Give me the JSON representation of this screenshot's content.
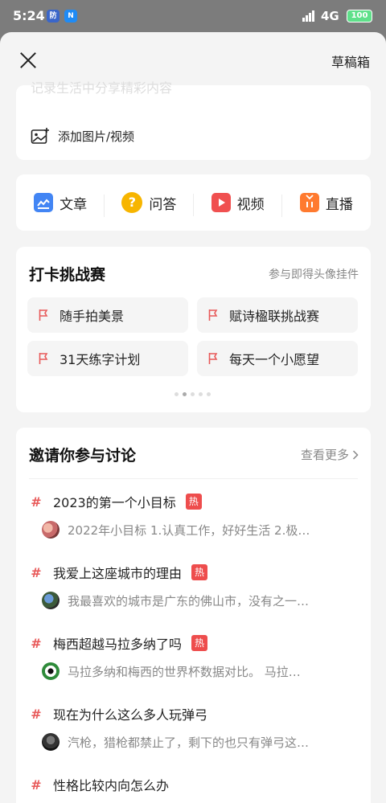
{
  "status": {
    "time": "5:24",
    "network": "4G",
    "battery": "100",
    "notif1": "防",
    "notif2": "N"
  },
  "header": {
    "drafts_label": "草稿箱"
  },
  "media": {
    "faded_text": "记录生活中分享精彩内容",
    "add_label": "添加图片/视频"
  },
  "post_types": [
    {
      "label": "文章",
      "icon": "article-icon",
      "color": "#4285f4"
    },
    {
      "label": "问答",
      "icon": "qa-icon",
      "color": "#f7b500"
    },
    {
      "label": "视频",
      "icon": "video-icon",
      "color": "#f05050"
    },
    {
      "label": "直播",
      "icon": "live-icon",
      "color": "#ff7a2f"
    }
  ],
  "challenge": {
    "title": "打卡挑战赛",
    "subtitle": "参与即得头像挂件",
    "items": [
      "随手拍美景",
      "赋诗楹联挑战赛",
      "31天练字计划",
      "每天一个小愿望"
    ]
  },
  "discussion": {
    "title": "邀请你参与讨论",
    "see_more": "查看更多",
    "topics": [
      {
        "title": "2023的第一个小目标",
        "hot": "热",
        "snippet": "2022年小目标 1.认真工作，好好生活 2.极…"
      },
      {
        "title": "我爱上这座城市的理由",
        "hot": "热",
        "snippet": "我最喜欢的城市是广东的佛山市，没有之一…"
      },
      {
        "title": "梅西超越马拉多纳了吗",
        "hot": "热",
        "snippet": "马拉多纳和梅西的世界杯数据对比。 马拉…"
      },
      {
        "title": "现在为什么这么多人玩弹弓",
        "snippet": "汽枪，猎枪都禁止了，剩下的也只有弹弓这…"
      },
      {
        "title": "性格比较内向怎么办"
      }
    ]
  },
  "colors": {
    "accent_red": "#e85a5a",
    "hot_red": "#ee4d4d"
  }
}
